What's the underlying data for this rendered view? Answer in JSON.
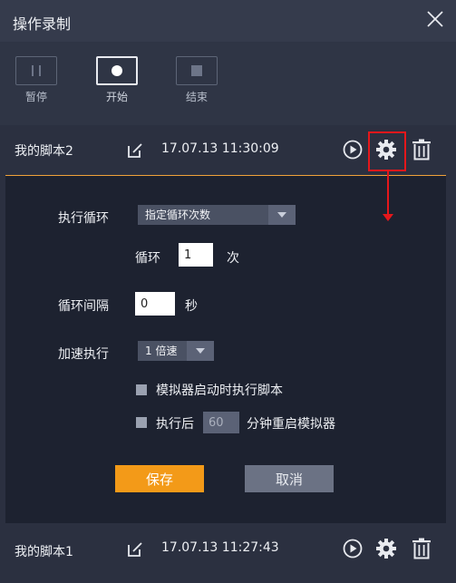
{
  "window": {
    "title": "操作录制"
  },
  "toolbar": {
    "pause_label": "暂停",
    "start_label": "开始",
    "stop_label": "结束"
  },
  "scripts": [
    {
      "name": "我的脚本2",
      "date": "17.07.13 11:30:09"
    },
    {
      "name": "我的脚本1",
      "date": "17.07.13 11:27:43"
    }
  ],
  "settings": {
    "loop_label": "执行循环",
    "loop_mode": "指定循环次数",
    "loop_count_label": "循环",
    "loop_count": "1",
    "loop_count_unit": "次",
    "interval_label": "循环间隔",
    "interval_value": "0",
    "interval_unit": "秒",
    "speed_label": "加速执行",
    "speed_value": "1 倍速",
    "opt_autorun_label": "模拟器启动时执行脚本",
    "opt_restart_prefix": "执行后",
    "opt_restart_minutes": "60",
    "opt_restart_suffix": "分钟重启模拟器",
    "save_label": "保存",
    "cancel_label": "取消"
  },
  "colors": {
    "accent": "#f39a18",
    "annotation": "#e5171b",
    "panel_bg": "#1d2230"
  }
}
